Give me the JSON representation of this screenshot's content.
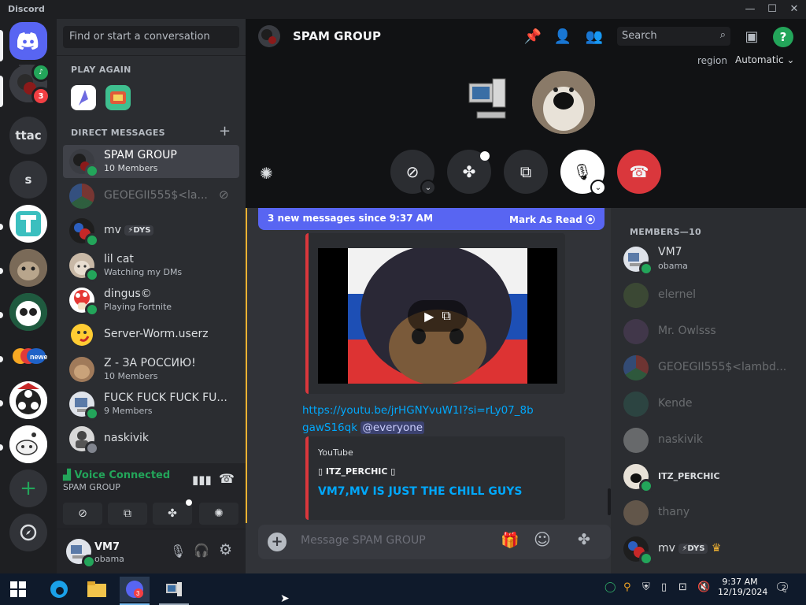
{
  "window": {
    "app_name": "Discord"
  },
  "colors": {
    "blurple": "#5865f2",
    "green": "#23a55a",
    "red": "#da373c",
    "mention_bg": "#3c4270",
    "link": "#00a8fc"
  },
  "rail": {
    "servers": [
      {
        "label": "ttac"
      },
      {
        "label": "s"
      }
    ],
    "badge_count": "3"
  },
  "sidebar": {
    "search_placeholder": "Find or start a conversation",
    "play_again_label": "PLAY AGAIN",
    "dm_header": "DIRECT MESSAGES",
    "dms": [
      {
        "name": "SPAM GROUP",
        "sub": "10 Members"
      },
      {
        "name": "GEOEGII555$<la...",
        "sub": ""
      },
      {
        "name": "mv",
        "tag": "DYS",
        "sub": ""
      },
      {
        "name": "lil cat",
        "sub": "Watching my DMs"
      },
      {
        "name": "dingus©",
        "sub": "Playing Fortnite"
      },
      {
        "name": "Server-Worm.userz",
        "sub": ""
      },
      {
        "name": "Z - ЗА РОССИЮ!",
        "sub": "10 Members"
      },
      {
        "name": "FUCK FUCK FUCK FU...",
        "sub": "9 Members"
      },
      {
        "name": "naskivik",
        "sub": ""
      }
    ]
  },
  "voice": {
    "status": "Voice Connected",
    "channel": "SPAM GROUP"
  },
  "user": {
    "name": "VM7",
    "sub": "obama"
  },
  "header": {
    "title": "SPAM GROUP",
    "search_placeholder": "Search",
    "region_label": "region",
    "region_value": "Automatic"
  },
  "chat": {
    "new_messages": "3 new messages since 9:37 AM",
    "mark_read": "Mark As Read",
    "link_text": "https://youtu.be/jrHGNYvuW1I?si=rLy07_8bgawS16qk",
    "mention": "@everyone",
    "embed_provider": "YouTube",
    "embed_author": "ITZ_PERCHIC",
    "embed_title": "VM7,MV IS JUST THE CHILL GUYS",
    "composer_placeholder": "Message SPAM GROUP"
  },
  "members": {
    "header": "MEMBERS—10",
    "list": [
      {
        "name": "VM7",
        "sub": "obama",
        "dim": false
      },
      {
        "name": "elernel",
        "dim": true
      },
      {
        "name": "Mr. Owlsss",
        "dim": true
      },
      {
        "name": "GEOEGII555$<lambd...",
        "dim": true
      },
      {
        "name": "Kende",
        "dim": true
      },
      {
        "name": "naskivik",
        "dim": true
      },
      {
        "name": "ITZ_PERCHIC",
        "dim": false
      },
      {
        "name": "thany",
        "dim": true
      },
      {
        "name": "mv",
        "tag": "DYS",
        "dim": false
      }
    ]
  },
  "taskbar": {
    "time": "9:37 AM",
    "date": "12/19/2024",
    "notif_count": "2"
  }
}
